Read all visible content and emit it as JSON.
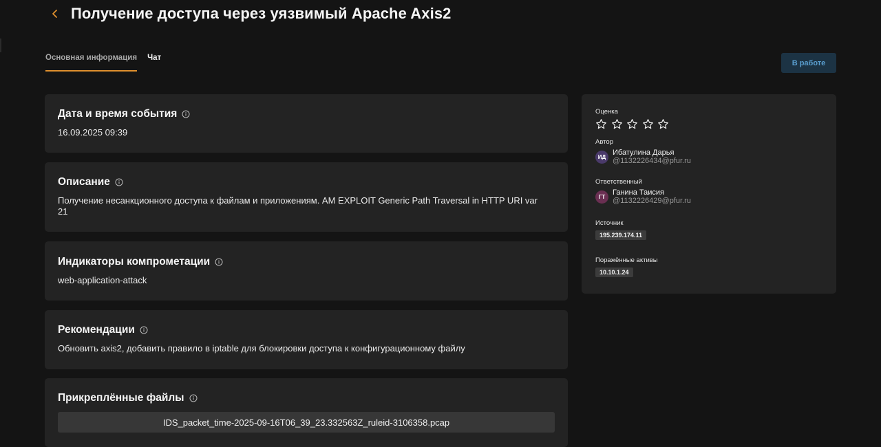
{
  "page": {
    "title": "Получение доступа через уязвимый Apache Axis2",
    "back_icon": "chevron-left-icon"
  },
  "tabs": [
    {
      "label": "Основная информация",
      "active": true
    },
    {
      "label": "Чат",
      "active": false
    }
  ],
  "status_button": {
    "label": "В работе"
  },
  "colors": {
    "accent": "#e0902e",
    "status_bg": "#1c3344",
    "status_text": "#5a9fd0",
    "background": "#141414",
    "card": "#232323"
  },
  "cards": {
    "datetime": {
      "title": "Дата и время события",
      "value": "16.09.2025 09:39"
    },
    "description": {
      "title": "Описание",
      "value": "Получение несанкционного доступа к файлам и приложениям. AM EXPLOIT Generic Path Traversal in HTTP URI var 21"
    },
    "indicators": {
      "title": "Индикаторы компрометации",
      "value": "web-application-attack"
    },
    "recommendations": {
      "title": "Рекомендации",
      "value": "Обновить axis2, добавить правило в iptable для блокировки доступа к конфигурационному файлу"
    },
    "files": {
      "title": "Прикреплённые файлы",
      "items": [
        "IDS_packet_time-2025-09-16T06_39_23.332563Z_ruleid-3106358.pcap"
      ]
    }
  },
  "sidebar": {
    "rating": {
      "label": "Оценка",
      "value": 0,
      "max": 5
    },
    "author": {
      "label": "Автор",
      "initials": "ИД",
      "name": "Ибатулина Дарья",
      "email": "@1132226434@pfur.ru",
      "avatar_color": "#4a3a6a"
    },
    "responsible": {
      "label": "Ответственный",
      "initials": "ГТ",
      "name": "Ганина Таисия",
      "email": "@1132226429@pfur.ru",
      "avatar_color": "#6a2f52"
    },
    "source": {
      "label": "Источник",
      "value": "195.239.174.11"
    },
    "affected": {
      "label": "Поражённые активы",
      "value": "10.10.1.24"
    }
  }
}
